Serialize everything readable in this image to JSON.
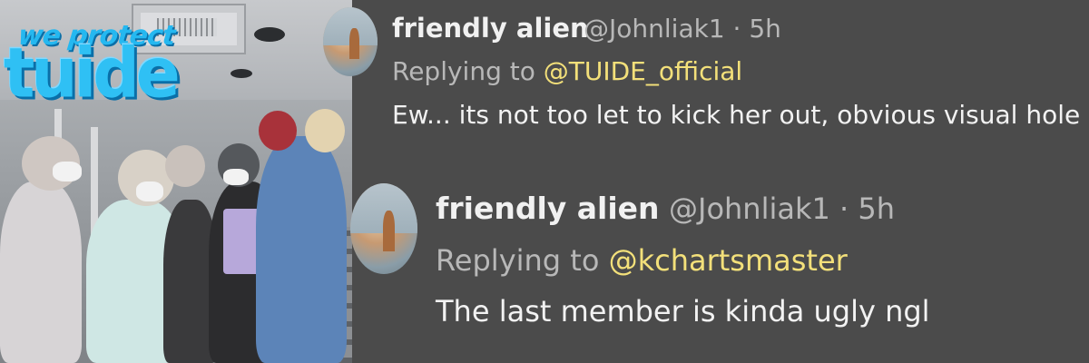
{
  "photo": {
    "overlay_small": "we protect",
    "overlay_large": "tuide",
    "overlay_color": "#2fc0f4"
  },
  "tweets": [
    {
      "display_name": "friendly alien",
      "handle_time": "@Johnliak1 · 5h",
      "replying_prefix": "Replying to ",
      "replying_mention": "@TUIDE_official",
      "text": "Ew... its not too let to kick her out, obvious visual hole"
    },
    {
      "display_name": "friendly alien",
      "handle_time": "@Johnliak1 · 5h",
      "replying_prefix": "Replying to ",
      "replying_mention": "@kchartsmaster",
      "text": "The last member is kinda ugly ngl"
    }
  ],
  "colors": {
    "background": "#4b4b4b",
    "mention": "#f3e07a",
    "secondary_text": "#b8b8b8",
    "primary_text": "#f2f2f2"
  }
}
